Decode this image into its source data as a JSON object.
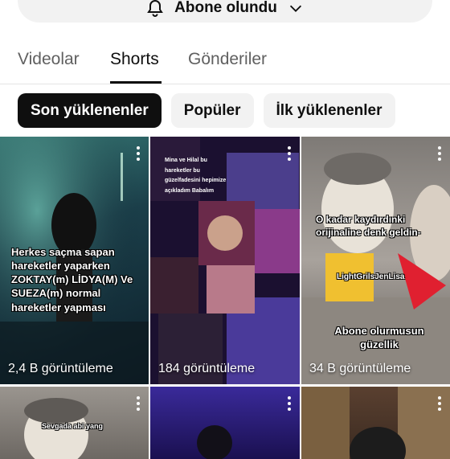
{
  "subscribe": {
    "label": "Abone olundu"
  },
  "tabs": [
    {
      "label": "Videolar"
    },
    {
      "label": "Shorts"
    },
    {
      "label": "Gönderiler"
    }
  ],
  "chips": [
    {
      "label": "Son yüklenenler"
    },
    {
      "label": "Popüler"
    },
    {
      "label": "İlk yüklenenler"
    }
  ],
  "shorts": [
    {
      "views": "2,4 B görüntüleme",
      "overlay": "Herkes saçma sapan hareketler yaparken ZOKTAY(m) LİDYA(M) Ve SUEZA(m) normal hareketler yapması"
    },
    {
      "views": "184 görüntüleme",
      "overlay": "Mina ve Hilal bu hareketler bu güzelfadesini hepimize açıkladım Babalım"
    },
    {
      "views": "34 B görüntüleme",
      "overlay": "O kadar kaydırdınki orijinaline denk geldin-",
      "overlay2": "LightGrilsJenLisa",
      "overlay3": "Abone olurmusun güzellik"
    },
    {
      "views": "",
      "overlay": "Sevgada abi yang"
    },
    {
      "views": "",
      "overlay": ""
    },
    {
      "views": "",
      "overlay": ""
    }
  ],
  "colors": {
    "selected_chip": "#0f0f0f",
    "chip": "#f2f2f2",
    "tab_inactive": "#606060"
  }
}
